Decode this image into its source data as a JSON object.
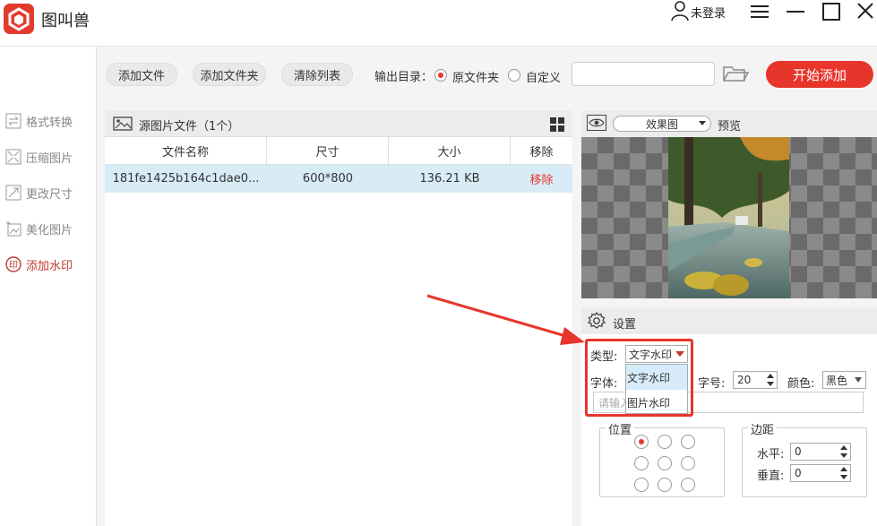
{
  "app": {
    "title": "图叫兽",
    "login_label": "未登录"
  },
  "sidebar": {
    "items": [
      {
        "label": "格式转换",
        "icon": "convert-icon",
        "active": false
      },
      {
        "label": "压缩图片",
        "icon": "compress-icon",
        "active": false
      },
      {
        "label": "更改尺寸",
        "icon": "resize-icon",
        "active": false
      },
      {
        "label": "美化图片",
        "icon": "beautify-icon",
        "active": false
      },
      {
        "label": "添加水印",
        "icon": "watermark-icon",
        "active": true
      }
    ]
  },
  "toolbar": {
    "add_file": "添加文件",
    "add_folder": "添加文件夹",
    "clear_list": "清除列表",
    "output_label": "输出目录：",
    "radio_original": "原文件夹",
    "radio_custom": "自定义",
    "path_value": "",
    "start": "开始添加"
  },
  "source": {
    "title": "源图片文件（1个）",
    "columns": [
      "文件名称",
      "尺寸",
      "大小",
      "移除"
    ],
    "rows": [
      {
        "name": "181fe1425b164c1dae0...",
        "size": "600*800",
        "bytes": "136.21 KB",
        "remove": "移除"
      }
    ]
  },
  "preview": {
    "mode": "效果图",
    "label": "预览"
  },
  "settings": {
    "title": "设置",
    "type_label": "类型:",
    "type_value": "文字水印",
    "type_options": [
      "文字水印",
      "图片水印"
    ],
    "font_label": "字体:",
    "font_size_label": "字号:",
    "font_size_value": "20",
    "color_label": "颜色:",
    "color_value": "黑色",
    "text_placeholder": "请输入",
    "position_title": "位置",
    "position_selected": "top-left",
    "margin_title": "边距",
    "horizontal_label": "水平:",
    "horizontal_value": "0",
    "vertical_label": "垂直:",
    "vertical_value": "0"
  },
  "colors": {
    "accent": "#e8352b",
    "selected_row": "#d8ecf8"
  }
}
